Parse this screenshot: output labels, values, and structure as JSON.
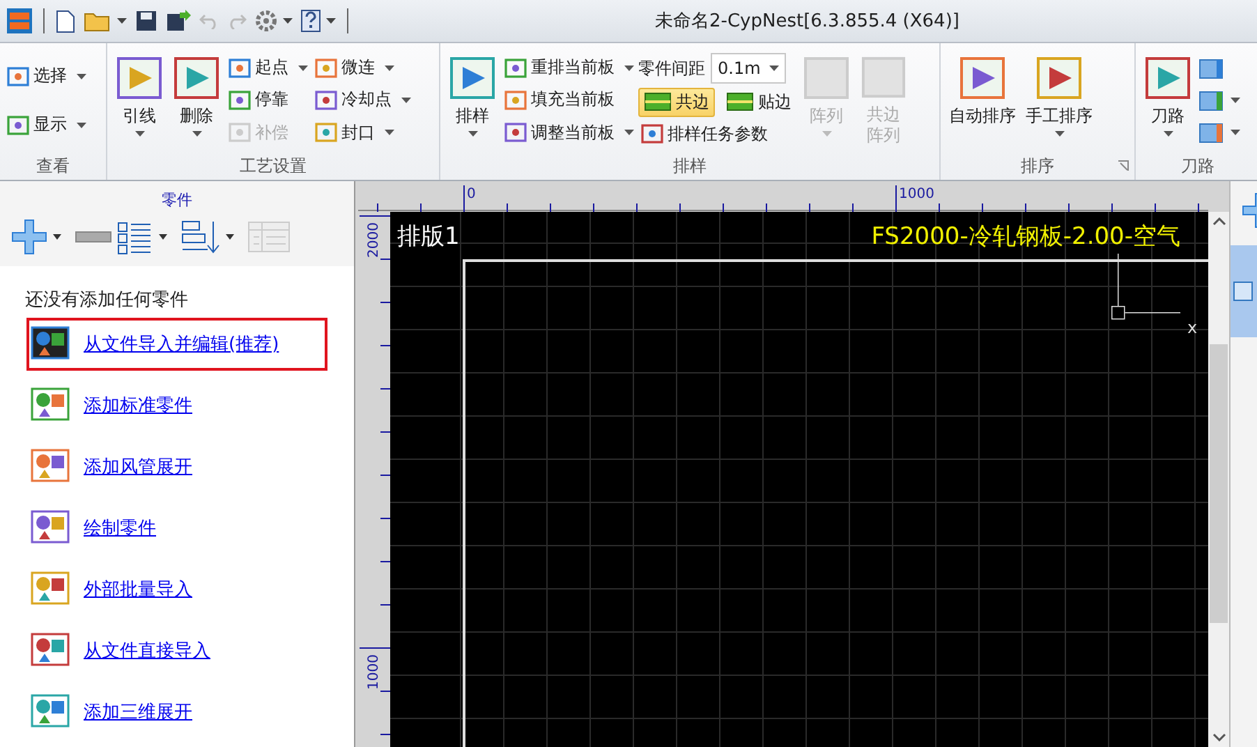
{
  "title_bar": {
    "title": "未命名2-CypNest[6.3.855.4 (X64)]"
  },
  "ribbon": {
    "groups": [
      {
        "label": "查看",
        "columns": [
          {
            "kind": "stack",
            "items": [
              {
                "kind": "button",
                "label": "选择",
                "dropdown": true,
                "disabled": false
              },
              {
                "kind": "button",
                "label": "显示",
                "dropdown": true,
                "disabled": false
              }
            ]
          }
        ]
      },
      {
        "label": "工艺设置",
        "columns": [
          {
            "kind": "large",
            "items": [
              {
                "kind": "button",
                "label": "引线",
                "dropdown": true,
                "disabled": false
              }
            ]
          },
          {
            "kind": "large",
            "items": [
              {
                "kind": "button",
                "label": "删除",
                "dropdown": true,
                "disabled": false
              }
            ]
          },
          {
            "kind": "stack",
            "items": [
              {
                "kind": "button",
                "label": "起点",
                "dropdown": true,
                "disabled": false
              },
              {
                "kind": "button",
                "label": "停靠",
                "dropdown": false,
                "disabled": false
              },
              {
                "kind": "button",
                "label": "补偿",
                "dropdown": false,
                "disabled": true
              }
            ]
          },
          {
            "kind": "stack",
            "items": [
              {
                "kind": "button",
                "label": "微连",
                "dropdown": true,
                "disabled": false
              },
              {
                "kind": "button",
                "label": "冷却点",
                "dropdown": true,
                "disabled": false
              },
              {
                "kind": "button",
                "label": "封口",
                "dropdown": true,
                "disabled": false
              }
            ]
          }
        ]
      },
      {
        "label": "排样",
        "columns": [
          {
            "kind": "large",
            "items": [
              {
                "kind": "button",
                "label": "排样",
                "dropdown": true,
                "disabled": false
              }
            ]
          },
          {
            "kind": "stack",
            "items": [
              {
                "kind": "button",
                "label": "重排当前板",
                "dropdown": true,
                "disabled": false
              },
              {
                "kind": "button",
                "label": "填充当前板",
                "dropdown": false,
                "disabled": false
              },
              {
                "kind": "button",
                "label": "调整当前板",
                "dropdown": true,
                "disabled": false
              }
            ]
          },
          {
            "kind": "stack",
            "items": [
              {
                "kind": "field",
                "label": "零件间距",
                "value": "0.1m"
              },
              {
                "kind": "toggles",
                "buttons": [
                  {
                    "label": "共边",
                    "selected": true
                  },
                  {
                    "label": "贴边",
                    "selected": false
                  }
                ]
              },
              {
                "kind": "button",
                "label": "排样任务参数",
                "dropdown": false,
                "disabled": false
              }
            ]
          },
          {
            "kind": "large",
            "items": [
              {
                "kind": "button",
                "label": "阵列",
                "dropdown": true,
                "disabled": true
              }
            ]
          },
          {
            "kind": "large",
            "items": [
              {
                "kind": "button",
                "label": "共边阵列",
                "dropdown": false,
                "disabled": true
              }
            ]
          }
        ]
      },
      {
        "label": "排序",
        "launcher": true,
        "columns": [
          {
            "kind": "large",
            "items": [
              {
                "kind": "button",
                "label": "自动排序",
                "dropdown": false,
                "disabled": false
              }
            ]
          },
          {
            "kind": "large",
            "items": [
              {
                "kind": "button",
                "label": "手工排序",
                "dropdown": true,
                "disabled": false
              }
            ]
          }
        ]
      },
      {
        "label": "刀路",
        "columns": [
          {
            "kind": "large",
            "items": [
              {
                "kind": "button",
                "label": "刀路",
                "dropdown": true,
                "disabled": false
              }
            ]
          },
          {
            "kind": "stack",
            "items": [
              {
                "kind": "icon",
                "dropdown": false
              },
              {
                "kind": "icon",
                "dropdown": true
              },
              {
                "kind": "icon",
                "dropdown": true
              }
            ]
          }
        ]
      }
    ]
  },
  "parts_panel": {
    "title": "零件",
    "empty_message": "还没有添加任何零件",
    "links": [
      {
        "label": "从文件导入并编辑(推荐)",
        "highlighted": true
      },
      {
        "label": "添加标准零件",
        "highlighted": false
      },
      {
        "label": "添加风管展开",
        "highlighted": false
      },
      {
        "label": "绘制零件",
        "highlighted": false
      },
      {
        "label": "外部批量导入",
        "highlighted": false
      },
      {
        "label": "从文件直接导入",
        "highlighted": false
      },
      {
        "label": "添加三维展开",
        "highlighted": false
      }
    ]
  },
  "canvas": {
    "top_ruler": [
      "0",
      "1000"
    ],
    "left_ruler": [
      "2000",
      "1000"
    ],
    "sheet_name": "排版1",
    "material": "FS2000-冷轧钢板-2.00-空气",
    "axis_label": "x"
  }
}
